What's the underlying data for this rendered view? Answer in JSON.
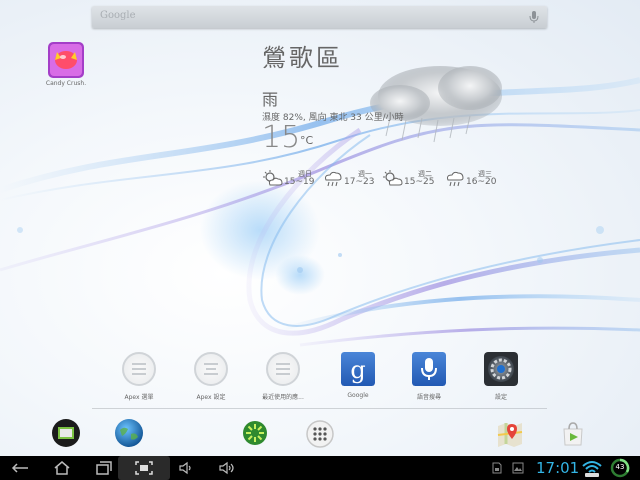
{
  "search": {
    "label": "Google",
    "icon": "mic-icon"
  },
  "desktop_app": {
    "label": "Candy Crush."
  },
  "weather": {
    "city": "鶯歌區",
    "condition": "雨",
    "detail": "濕度 82%, 風向 東北 33 公里/小時",
    "temp": "15",
    "unit": "°C",
    "forecast": [
      {
        "day": "週日",
        "range": "15~19",
        "icon": "partly-cloudy-icon"
      },
      {
        "day": "週一",
        "range": "17~23",
        "icon": "rain-icon"
      },
      {
        "day": "週二",
        "range": "15~25",
        "icon": "partly-cloudy-icon"
      },
      {
        "day": "週三",
        "range": "16~20",
        "icon": "rain-icon"
      }
    ]
  },
  "dock_apps": [
    {
      "label": "Apex 選單",
      "icon": "apex-menu-icon"
    },
    {
      "label": "Apex 設定",
      "icon": "apex-settings-icon"
    },
    {
      "label": "最近使用的應...",
      "icon": "recent-apps-icon"
    },
    {
      "label": "Google",
      "icon": "google-search-icon"
    },
    {
      "label": "語音搜尋",
      "icon": "voice-search-icon"
    },
    {
      "label": "設定",
      "icon": "settings-icon"
    }
  ],
  "hotseat": [
    {
      "icon": "file-manager-icon"
    },
    {
      "icon": "browser-globe-icon"
    },
    {
      "icon": "media-center-icon"
    },
    {
      "icon": "app-drawer-icon"
    },
    {
      "icon": "maps-icon"
    },
    {
      "icon": "play-store-icon"
    }
  ],
  "status": {
    "time": "17:01",
    "battery": "43"
  },
  "colors": {
    "clock": "#33b5e5",
    "navbar": "#000000"
  }
}
